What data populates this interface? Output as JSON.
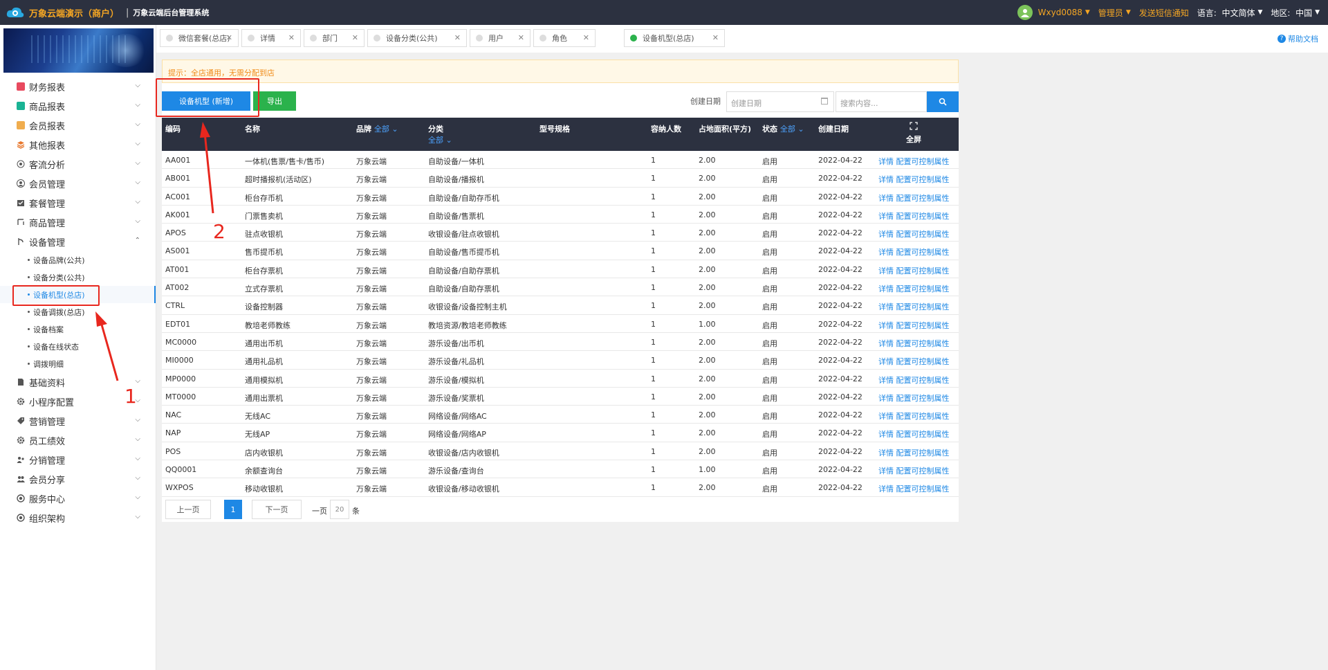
{
  "header": {
    "brand": "万象云端演示（商户）",
    "separator": "|",
    "subtitle": "万象云端后台管理系统",
    "user": "Wxyd0088",
    "role": "管理员",
    "sms": "发送短信通知",
    "lang_label": "语言:",
    "lang_value": "中文简体",
    "region_label": "地区:",
    "region_value": "中国"
  },
  "sidebar": {
    "items": [
      {
        "label": "财务报表",
        "icon": "finance-report-icon",
        "color": "#e84a5f"
      },
      {
        "label": "商品报表",
        "icon": "goods-report-icon",
        "color": "#1ab394"
      },
      {
        "label": "会员报表",
        "icon": "member-report-icon",
        "color": "#f0ad4e"
      },
      {
        "label": "其他报表",
        "icon": "layers-icon",
        "color": "#e8782e"
      },
      {
        "label": "客流分析",
        "icon": "target-icon",
        "color": "#555555"
      },
      {
        "label": "会员管理",
        "icon": "user-icon",
        "color": "#555555"
      },
      {
        "label": "套餐管理",
        "icon": "package-icon",
        "color": "#555555"
      },
      {
        "label": "商品管理",
        "icon": "swap-icon",
        "color": "#555555"
      },
      {
        "label": "设备管理",
        "icon": "device-icon",
        "color": "#555555"
      }
    ],
    "sub_items": [
      {
        "label": "设备品牌(公共)"
      },
      {
        "label": "设备分类(公共)"
      },
      {
        "label": "设备机型(总店)"
      },
      {
        "label": "设备调拨(总店)"
      },
      {
        "label": "设备档案"
      },
      {
        "label": "设备在线状态"
      },
      {
        "label": "调拨明细"
      }
    ],
    "items_after": [
      {
        "label": "基础资料",
        "icon": "document-icon"
      },
      {
        "label": "小程序配置",
        "icon": "gear-icon"
      },
      {
        "label": "营销管理",
        "icon": "tag-icon"
      },
      {
        "label": "员工绩效",
        "icon": "gear-icon"
      },
      {
        "label": "分销管理",
        "icon": "share-users-icon"
      },
      {
        "label": "会员分享",
        "icon": "users-icon"
      },
      {
        "label": "服务中心",
        "icon": "record-icon"
      },
      {
        "label": "组织架构",
        "icon": "record-icon"
      }
    ]
  },
  "tabs": [
    {
      "label": "微信套餐(总店)",
      "active": false
    },
    {
      "label": "详情",
      "active": false
    },
    {
      "label": "部门",
      "active": false
    },
    {
      "label": "设备分类(公共)",
      "active": false
    },
    {
      "label": "用户",
      "active": false
    },
    {
      "label": "角色",
      "active": false
    },
    {
      "label": "设备机型(总店)",
      "active": true
    }
  ],
  "help": "帮助文档",
  "notice": "提示：全店通用，无需分配到店",
  "toolbar": {
    "add_label": "设备机型 (新增)",
    "export_label": "导出",
    "date_label": "创建日期",
    "date_placeholder": "创建日期",
    "search_placeholder": "搜索内容..."
  },
  "table": {
    "headers": {
      "code": "编码",
      "name": "名称",
      "brand": "品牌",
      "brand_filter": "全部",
      "category": "分类",
      "category_filter": "全部",
      "spec": "型号规格",
      "capacity": "容纳人数",
      "area": "占地面积(平方)",
      "status": "状态",
      "status_filter": "全部",
      "created": "创建日期",
      "fullscreen": "全屏"
    },
    "rows": [
      {
        "code": "AA001",
        "name": "一体机(售票/售卡/售币)",
        "brand": "万象云端",
        "category": "自助设备/一体机",
        "spec": "",
        "capacity": "1",
        "area": "2.00",
        "status": "启用",
        "created": "2022-04-22",
        "links": "详情 配置可控制属性"
      },
      {
        "code": "AB001",
        "name": "超时播报机(活动区)",
        "brand": "万象云端",
        "category": "自助设备/播报机",
        "spec": "",
        "capacity": "1",
        "area": "2.00",
        "status": "启用",
        "created": "2022-04-22",
        "links": "详情 配置可控制属性"
      },
      {
        "code": "AC001",
        "name": "柜台存币机",
        "brand": "万象云端",
        "category": "自助设备/自助存币机",
        "spec": "",
        "capacity": "1",
        "area": "2.00",
        "status": "启用",
        "created": "2022-04-22",
        "links": "详情 配置可控制属性"
      },
      {
        "code": "AK001",
        "name": "门票售卖机",
        "brand": "万象云端",
        "category": "自助设备/售票机",
        "spec": "",
        "capacity": "1",
        "area": "2.00",
        "status": "启用",
        "created": "2022-04-22",
        "links": "详情 配置可控制属性"
      },
      {
        "code": "APOS",
        "name": "驻点收银机",
        "brand": "万象云端",
        "category": "收银设备/驻点收银机",
        "spec": "",
        "capacity": "1",
        "area": "2.00",
        "status": "启用",
        "created": "2022-04-22",
        "links": "详情 配置可控制属性"
      },
      {
        "code": "AS001",
        "name": "售币提币机",
        "brand": "万象云端",
        "category": "自助设备/售币提币机",
        "spec": "",
        "capacity": "1",
        "area": "2.00",
        "status": "启用",
        "created": "2022-04-22",
        "links": "详情 配置可控制属性"
      },
      {
        "code": "AT001",
        "name": "柜台存票机",
        "brand": "万象云端",
        "category": "自助设备/自助存票机",
        "spec": "",
        "capacity": "1",
        "area": "2.00",
        "status": "启用",
        "created": "2022-04-22",
        "links": "详情 配置可控制属性"
      },
      {
        "code": "AT002",
        "name": "立式存票机",
        "brand": "万象云端",
        "category": "自助设备/自助存票机",
        "spec": "",
        "capacity": "1",
        "area": "2.00",
        "status": "启用",
        "created": "2022-04-22",
        "links": "详情 配置可控制属性"
      },
      {
        "code": "CTRL",
        "name": "设备控制器",
        "brand": "万象云端",
        "category": "收银设备/设备控制主机",
        "spec": "",
        "capacity": "1",
        "area": "2.00",
        "status": "启用",
        "created": "2022-04-22",
        "links": "详情 配置可控制属性"
      },
      {
        "code": "EDT01",
        "name": "教培老师教练",
        "brand": "万象云端",
        "category": "教培资源/教培老师教练",
        "spec": "",
        "capacity": "1",
        "area": "1.00",
        "status": "启用",
        "created": "2022-04-22",
        "links": "详情 配置可控制属性"
      },
      {
        "code": "MC0000",
        "name": "通用出币机",
        "brand": "万象云端",
        "category": "游乐设备/出币机",
        "spec": "",
        "capacity": "1",
        "area": "2.00",
        "status": "启用",
        "created": "2022-04-22",
        "links": "详情 配置可控制属性"
      },
      {
        "code": "MI0000",
        "name": "通用礼品机",
        "brand": "万象云端",
        "category": "游乐设备/礼品机",
        "spec": "",
        "capacity": "1",
        "area": "2.00",
        "status": "启用",
        "created": "2022-04-22",
        "links": "详情 配置可控制属性"
      },
      {
        "code": "MP0000",
        "name": "通用模拟机",
        "brand": "万象云端",
        "category": "游乐设备/模拟机",
        "spec": "",
        "capacity": "1",
        "area": "2.00",
        "status": "启用",
        "created": "2022-04-22",
        "links": "详情 配置可控制属性"
      },
      {
        "code": "MT0000",
        "name": "通用出票机",
        "brand": "万象云端",
        "category": "游乐设备/奖票机",
        "spec": "",
        "capacity": "1",
        "area": "2.00",
        "status": "启用",
        "created": "2022-04-22",
        "links": "详情 配置可控制属性"
      },
      {
        "code": "NAC",
        "name": "无线AC",
        "brand": "万象云端",
        "category": "网络设备/网络AC",
        "spec": "",
        "capacity": "1",
        "area": "2.00",
        "status": "启用",
        "created": "2022-04-22",
        "links": "详情 配置可控制属性"
      },
      {
        "code": "NAP",
        "name": "无线AP",
        "brand": "万象云端",
        "category": "网络设备/网络AP",
        "spec": "",
        "capacity": "1",
        "area": "2.00",
        "status": "启用",
        "created": "2022-04-22",
        "links": "详情 配置可控制属性"
      },
      {
        "code": "POS",
        "name": "店内收银机",
        "brand": "万象云端",
        "category": "收银设备/店内收银机",
        "spec": "",
        "capacity": "1",
        "area": "2.00",
        "status": "启用",
        "created": "2022-04-22",
        "links": "详情 配置可控制属性"
      },
      {
        "code": "QQ0001",
        "name": "余额查询台",
        "brand": "万象云端",
        "category": "游乐设备/查询台",
        "spec": "",
        "capacity": "1",
        "area": "1.00",
        "status": "启用",
        "created": "2022-04-22",
        "links": "详情 配置可控制属性"
      },
      {
        "code": "WXPOS",
        "name": "移动收银机",
        "brand": "万象云端",
        "category": "收银设备/移动收银机",
        "spec": "",
        "capacity": "1",
        "area": "2.00",
        "status": "启用",
        "created": "2022-04-22",
        "links": "详情 配置可控制属性"
      }
    ]
  },
  "pager": {
    "prev": "上一页",
    "current": "1",
    "next": "下一页",
    "per_page_prefix": "一页",
    "per_page": "20",
    "per_page_suffix": "条"
  },
  "annotations": {
    "marker_1": "1",
    "marker_2": "2",
    "color": "#e8271e"
  }
}
